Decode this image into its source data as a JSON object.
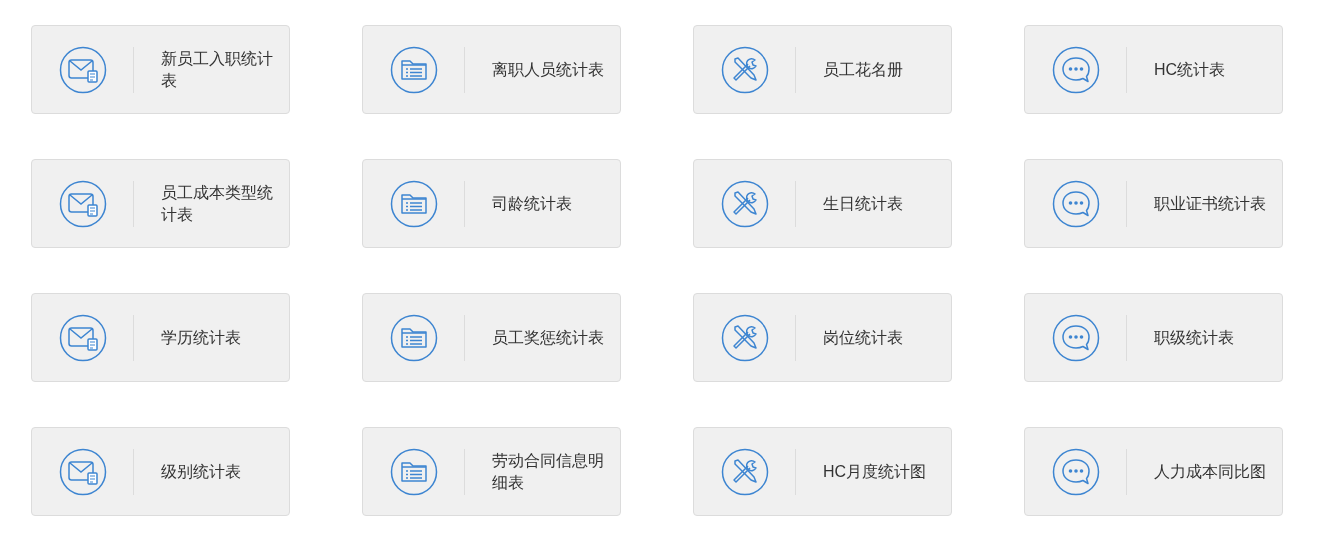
{
  "tiles": [
    {
      "kind": "mail",
      "label": "新员工入职统计表"
    },
    {
      "kind": "folder",
      "label": "离职人员统计表"
    },
    {
      "kind": "tools",
      "label": "员工花名册"
    },
    {
      "kind": "chat",
      "label": "HC统计表"
    },
    {
      "kind": "mail",
      "label": "员工成本类型统计表"
    },
    {
      "kind": "folder",
      "label": "司龄统计表"
    },
    {
      "kind": "tools",
      "label": "生日统计表"
    },
    {
      "kind": "chat",
      "label": "职业证书统计表"
    },
    {
      "kind": "mail",
      "label": "学历统计表"
    },
    {
      "kind": "folder",
      "label": "员工奖惩统计表"
    },
    {
      "kind": "tools",
      "label": "岗位统计表"
    },
    {
      "kind": "chat",
      "label": "职级统计表"
    },
    {
      "kind": "mail",
      "label": "级别统计表"
    },
    {
      "kind": "folder",
      "label": "劳动合同信息明细表"
    },
    {
      "kind": "tools",
      "label": "HC月度统计图"
    },
    {
      "kind": "chat",
      "label": "人力成本同比图"
    }
  ]
}
